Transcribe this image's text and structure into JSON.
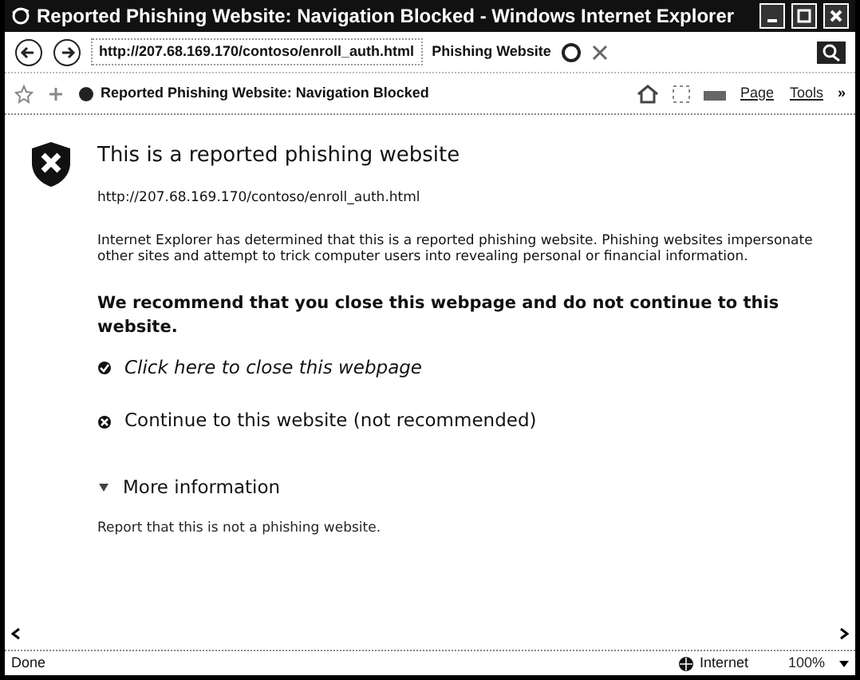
{
  "window": {
    "title": "Reported Phishing Website: Navigation Blocked - Windows Internet Explorer"
  },
  "address_bar": {
    "url": "http://207.68.169.170/contoso/enroll_auth.html",
    "warning": "Phishing Website"
  },
  "tab": {
    "label": "Reported Phishing Website: Navigation Blocked"
  },
  "toolbar": {
    "menus": [
      {
        "label": "Page"
      },
      {
        "label": "Tools"
      }
    ],
    "overflow": "»"
  },
  "page": {
    "heading": "This is a reported phishing website",
    "url": "http://207.68.169.170/contoso/enroll_auth.html",
    "description": "Internet Explorer has determined that this is a reported phishing website. Phishing websites impersonate other sites and attempt to trick computer users into revealing personal or financial information.",
    "recommendation": "We recommend that you close this webpage and do not continue to this website.",
    "actions": [
      {
        "kind": "safe",
        "label": "Click here to close this webpage"
      },
      {
        "kind": "unsafe",
        "label": "Continue to this website (not recommended)"
      }
    ],
    "more_info": {
      "label": "More information",
      "expanded": false
    },
    "report_link": "Report that this is not a phishing website."
  },
  "status_bar": {
    "status": "Done",
    "zone": "Internet",
    "zoom": "100%"
  }
}
